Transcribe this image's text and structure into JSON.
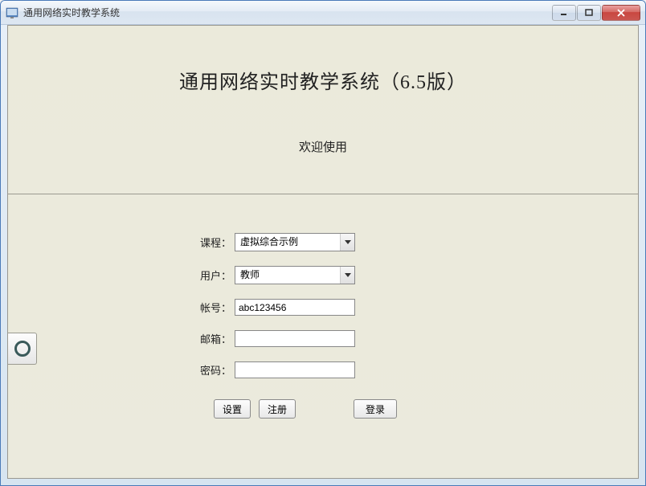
{
  "window": {
    "title": "通用网络实时教学系统"
  },
  "header": {
    "main_title": "通用网络实时教学系统（6.5版）",
    "welcome": "欢迎使用"
  },
  "form": {
    "course_label": "课程：",
    "course_value": "虚拟综合示例",
    "user_label": "用户：",
    "user_value": "教师",
    "account_label": "帐号：",
    "account_value": "abc123456",
    "email_label": "邮箱：",
    "email_value": "",
    "password_label": "密码：",
    "password_value": ""
  },
  "buttons": {
    "settings": "设置",
    "register": "注册",
    "login": "登录"
  }
}
